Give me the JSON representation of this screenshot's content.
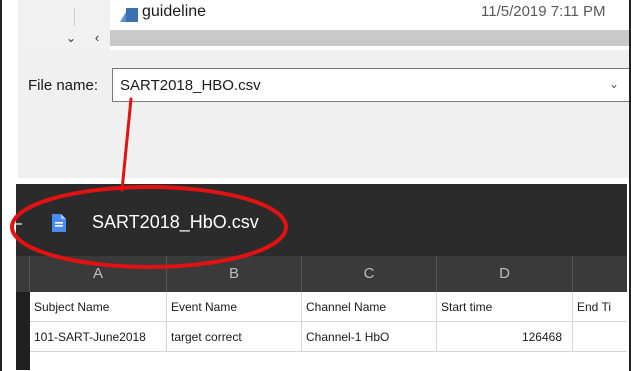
{
  "dialog": {
    "file_list": {
      "name": "guideline",
      "date": "11/5/2019 7:11 PM"
    },
    "scroll_down_glyph": "⌄",
    "scroll_left_glyph": "‹",
    "file_name_label": "File name:",
    "file_name_value": "SART2018_HBO.csv",
    "dropdown_glyph": "⌄"
  },
  "sheet": {
    "title": "SART2018_HbO.csv",
    "columns": [
      "A",
      "B",
      "C",
      "D",
      ""
    ],
    "rows": [
      [
        "Subject Name",
        "Event Name",
        "Channel Name",
        "Start time",
        "End Ti"
      ],
      [
        "101-SART-June2018",
        "target correct",
        "Channel-1 HbO",
        "126468",
        ""
      ]
    ]
  },
  "colors": {
    "sheet_bg": "#2b2b2b",
    "header_bg": "#3a3a3a",
    "annotation": "#e31212",
    "doc_icon": "#4a8cf7"
  }
}
